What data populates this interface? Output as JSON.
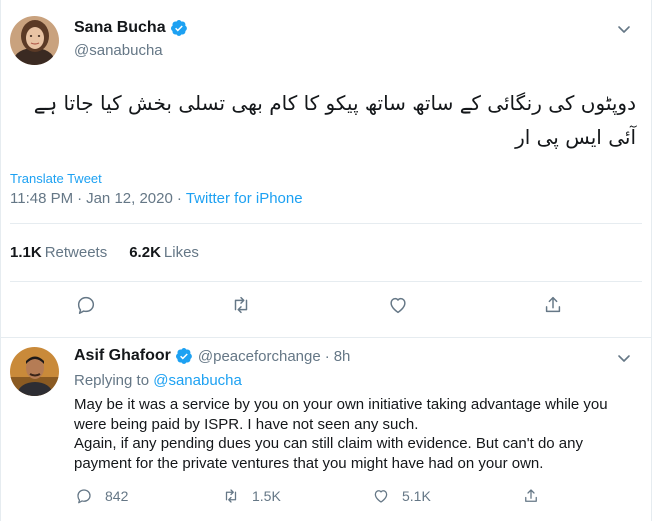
{
  "main_tweet": {
    "display_name": "Sana Bucha",
    "handle": "@sanabucha",
    "text_line1": "دوپٹوں کی رنگائی کے ساتھ ساتھ پیکو کا کام بھی تسلی بخش کیا جاتا ہے",
    "text_line2": "آئی ایس پی ار",
    "translate_label": "Translate Tweet",
    "time": "11:48 PM",
    "date": "Jan 12, 2020",
    "separator": "·",
    "source": "Twitter for iPhone",
    "retweets_count": "1.1K",
    "retweets_label": "Retweets",
    "likes_count": "6.2K",
    "likes_label": "Likes",
    "icons": [
      "reply-icon",
      "retweet-icon",
      "like-icon",
      "share-icon"
    ]
  },
  "reply": {
    "display_name": "Asif Ghafoor",
    "handle": "@peaceforchange",
    "separator": "·",
    "time": "8h",
    "replying_prefix": "Replying to",
    "replying_to": "@sanabucha",
    "text_p1": "May be it was a service by you on your own initiative taking advantage while you were being paid by ISPR. I have not seen any such.",
    "text_p2": "Again, if any pending dues you can still claim with evidence. But can't do any payment for the private ventures that you might have had on your own.",
    "reply_count": "842",
    "retweet_count": "1.5K",
    "like_count": "5.1K"
  },
  "colors": {
    "link_blue": "#1da1f2",
    "muted_gray": "#657786",
    "text_dark": "#14171a",
    "border": "#e6ecf0"
  }
}
